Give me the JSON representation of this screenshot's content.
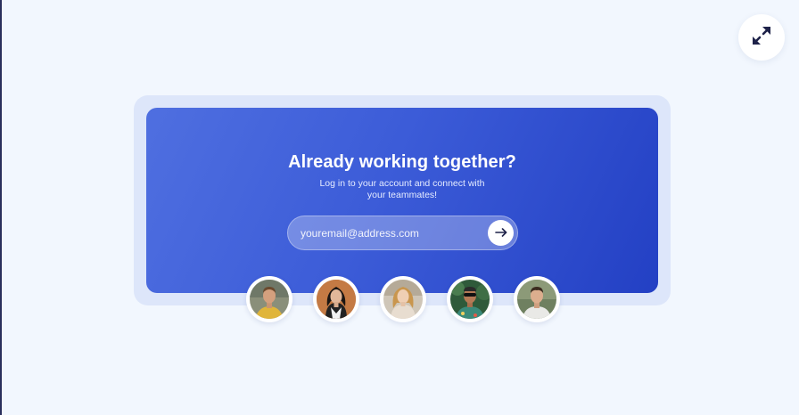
{
  "header": {
    "expand_icon": "expand-arrows-icon"
  },
  "card": {
    "title": "Already working together?",
    "subtitle": "Log in to your account and connect with your teammates!",
    "email": {
      "placeholder": "youremail@address.com",
      "value": ""
    },
    "submit_icon": "arrow-right-icon"
  },
  "teammates": [
    {
      "name": "teammate-1"
    },
    {
      "name": "teammate-2"
    },
    {
      "name": "teammate-3"
    },
    {
      "name": "teammate-4"
    },
    {
      "name": "teammate-5"
    }
  ],
  "colors": {
    "background": "#f2f7fe",
    "card_start": "#4f6fe0",
    "card_end": "#2340c4",
    "card_frame": "#dde6fa",
    "icon_dark": "#1e2249"
  }
}
